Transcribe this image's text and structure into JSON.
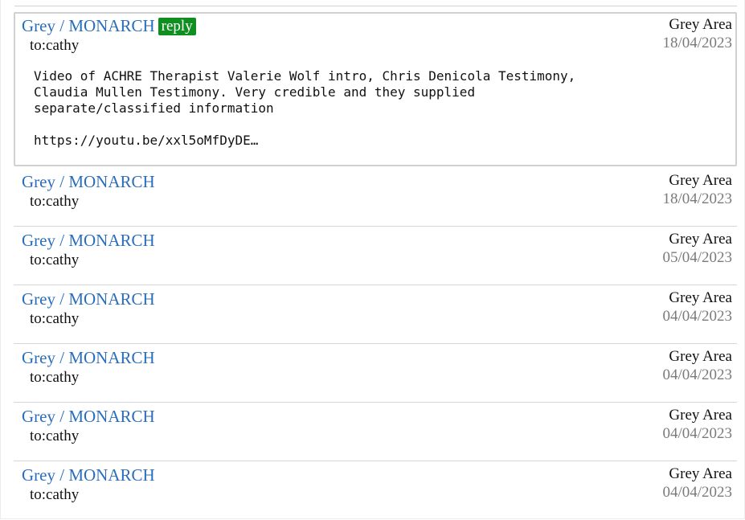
{
  "messages": [
    {
      "subject": "Grey / MONARCH",
      "reply_label": "reply",
      "to": "to:cathy",
      "author": "Grey Area",
      "date": "18/04/2023",
      "body": "Video of ACHRE Therapist Valerie Wolf intro, Chris Denicola Testimony,\nClaudia Mullen Testimony. Very credible and they supplied\nseparate/classified information",
      "link": "https://youtu.be/xxl5oMfDyDE…"
    },
    {
      "subject": "Grey / MONARCH",
      "to": "to:cathy",
      "author": "Grey Area",
      "date": "18/04/2023"
    },
    {
      "subject": "Grey / MONARCH",
      "to": "to:cathy",
      "author": "Grey Area",
      "date": "05/04/2023"
    },
    {
      "subject": "Grey / MONARCH",
      "to": "to:cathy",
      "author": "Grey Area",
      "date": "04/04/2023"
    },
    {
      "subject": "Grey / MONARCH",
      "to": "to:cathy",
      "author": "Grey Area",
      "date": "04/04/2023"
    },
    {
      "subject": "Grey / MONARCH",
      "to": "to:cathy",
      "author": "Grey Area",
      "date": "04/04/2023"
    },
    {
      "subject": "Grey / MONARCH",
      "to": "to:cathy",
      "author": "Grey Area",
      "date": "04/04/2023"
    }
  ],
  "colors": {
    "subject_link": "#2a6ebb",
    "reply_button": "#0f8f1f",
    "date_text": "#7a7a7a"
  }
}
